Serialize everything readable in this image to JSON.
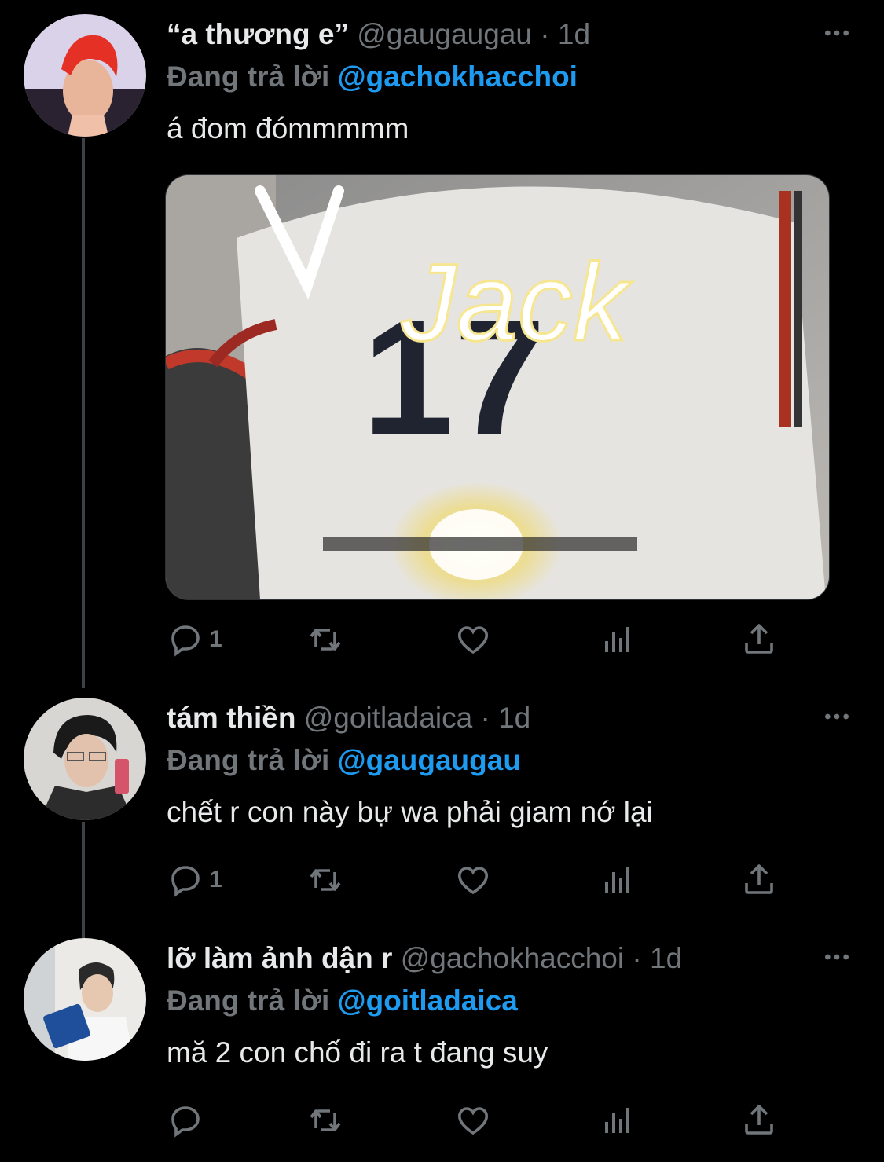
{
  "tweets": [
    {
      "name": "“a thương e”",
      "handle": "@gaugaugau",
      "separator": "·",
      "time": "1d",
      "replying_label": "Đang trả lời",
      "replying_to": "@gachokhacchoi",
      "text": "á đom đómmmmm",
      "reply_count": "1",
      "retweet_count": "",
      "like_count": "",
      "media_text": "Jack",
      "media_number": "17"
    },
    {
      "name": "tám thiền",
      "handle": "@goitladaica",
      "separator": "·",
      "time": "1d",
      "replying_label": "Đang trả lời",
      "replying_to": "@gaugaugau",
      "text": "chết r con này bự wa phải giam nớ lại",
      "reply_count": "1",
      "retweet_count": "",
      "like_count": ""
    },
    {
      "name": "lỡ làm ảnh dận r",
      "handle": "@gachokhacchoi",
      "separator": "·",
      "time": "1d",
      "replying_label": "Đang trả lời",
      "replying_to": "@goitladaica",
      "text": "mă 2 con chố đi ra t đang suy",
      "reply_count": "",
      "retweet_count": "",
      "like_count": ""
    }
  ],
  "icons": {
    "more": "more-horizontal-icon",
    "reply": "reply-icon",
    "retweet": "retweet-icon",
    "like": "heart-icon",
    "views": "analytics-icon",
    "share": "share-icon"
  },
  "colors": {
    "background": "#000000",
    "text": "#e7e9ea",
    "secondary": "#71767b",
    "accent": "#1d9bf0",
    "thread_line": "#3d4045"
  }
}
